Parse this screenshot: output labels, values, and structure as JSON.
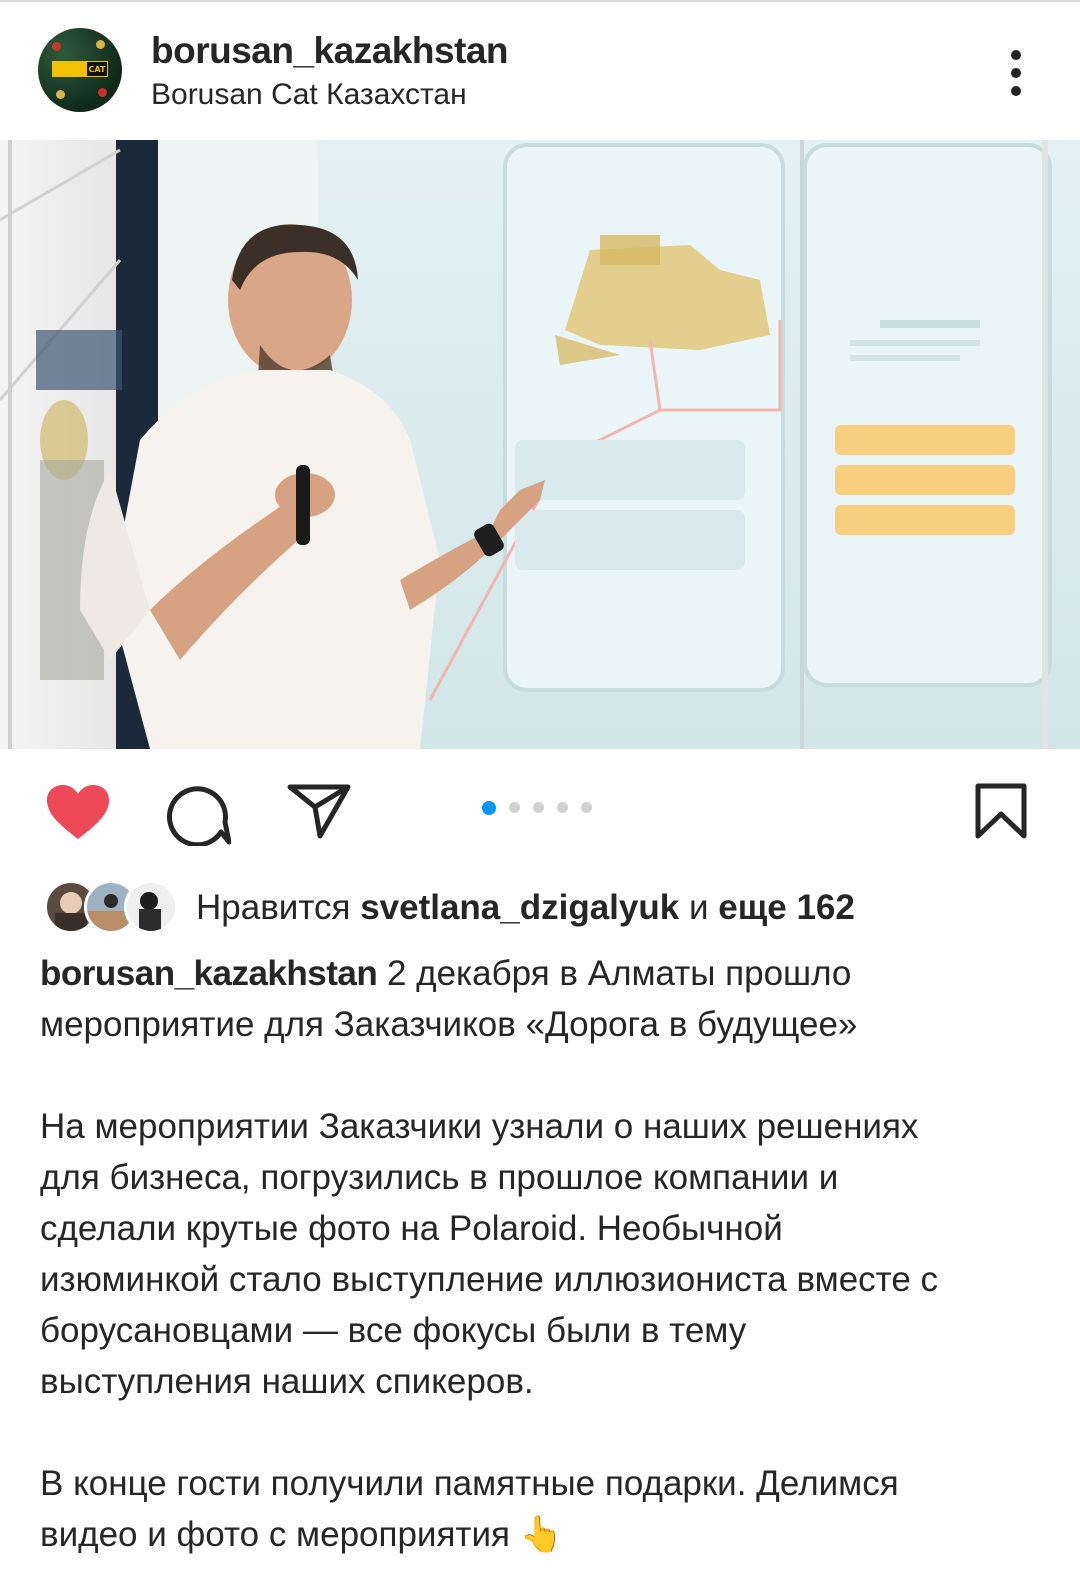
{
  "post": {
    "username": "borusan_kazakhstan",
    "subtitle": "Borusan Cat Казахстан",
    "avatar_badge_text": "CAT"
  },
  "carousel": {
    "total": 5,
    "active_index": 0
  },
  "likes": {
    "prefix": "Нравится",
    "liker": "svetlana_dzigalyuk",
    "middle": "и",
    "rest": "еще 162"
  },
  "caption": {
    "username": "borusan_kazakhstan",
    "para1": "2 декабря в Алматы прошло мероприятие для Заказчиков «Дорога в будущее»",
    "para2_lines": [
      "На мероприятии Заказчики узнали о наших решениях",
      "для бизнеса, погрузились в прошлое компании и",
      "сделали крутые фото на Polaroid. Необычной",
      "изюминкой стало выступление иллюзиониста вместе с",
      "борусановцами — все фокусы были в тему",
      "выступления наших спикеров."
    ],
    "para3_lines": [
      "В конце гости получили памятные подарки. Делимся",
      "видео и фото с мероприятия 👆"
    ]
  },
  "colors": {
    "like_red": "#ed4956",
    "carousel_active": "#0095f6",
    "text": "#262626"
  },
  "icons": {
    "like": "heart-icon",
    "comment": "comment-icon",
    "share": "paper-plane-icon",
    "save": "bookmark-icon",
    "more": "more-vertical-icon"
  }
}
